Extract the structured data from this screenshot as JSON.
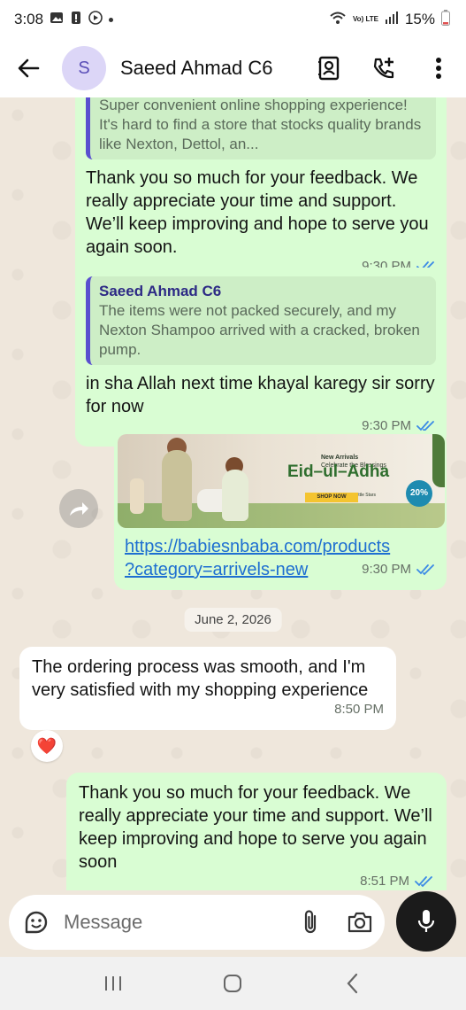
{
  "status_bar": {
    "time": "3:08",
    "network": "Vo) LTE",
    "battery": "15%"
  },
  "header": {
    "avatar_letter": "S",
    "contact_name": "Saeed Ahmad C6"
  },
  "messages": [
    {
      "direction": "outgoing",
      "quote": {
        "author": "",
        "text": "Super convenient online shopping experience! It's hard to find a store that stocks quality brands like Nexton, Dettol, an..."
      },
      "text": "Thank you so much for your feedback. We really appreciate your time and support. We’ll keep improving and hope to serve you again soon.",
      "time": "9:30 PM",
      "read": true
    },
    {
      "direction": "outgoing",
      "quote": {
        "author": "Saeed Ahmad C6",
        "text": "The items were not packed securely, and my Nexton Shampoo arrived with a cracked, broken pump."
      },
      "text": "in sha Allah next time khayal karegy sir sorry for now",
      "time": "9:30 PM",
      "read": true
    },
    {
      "direction": "outgoing",
      "banner": {
        "kicker": "New Arrivals",
        "tagline": "Celebrate the Blessings",
        "headline": "Eid–ul–Adha",
        "subline": "Elegant Festive Wear for Little Stars",
        "cta": "SHOP NOW",
        "badge": "20%"
      },
      "link": "https://babiesnbaba.com/products?category=arrivels-new",
      "link_line1": "https://babiesnbaba.com/products",
      "link_line2": "?category=arrivels-new",
      "time": "9:30 PM",
      "read": true
    },
    {
      "direction": "incoming",
      "text": "The ordering process was smooth, and I'm very satisfied with my shopping experience",
      "time": "8:50 PM",
      "reaction": "❤️"
    },
    {
      "direction": "outgoing",
      "text": "Thank you so much for your feedback. We really appreciate your time and support. We’ll keep improving and hope to serve you again soon",
      "time": "8:51 PM",
      "read": true
    }
  ],
  "date_divider": "June 2, 2026",
  "composer": {
    "placeholder": "Message"
  },
  "colors": {
    "outgoing_bubble": "#d9fdd3",
    "incoming_bubble": "#ffffff",
    "chat_background": "#efe7dc",
    "read_ticks": "#3b8ae6",
    "link": "#1e6fd1",
    "quote_bar": "#5a4fcf"
  },
  "icons": {
    "back": "arrow-left-icon",
    "contact_card": "contact-card-icon",
    "add_call": "call-add-icon",
    "menu": "more-vert-icon",
    "forward": "forward-icon",
    "emoji": "sticker-icon",
    "attach": "paperclip-icon",
    "camera": "camera-icon",
    "mic": "mic-icon"
  }
}
